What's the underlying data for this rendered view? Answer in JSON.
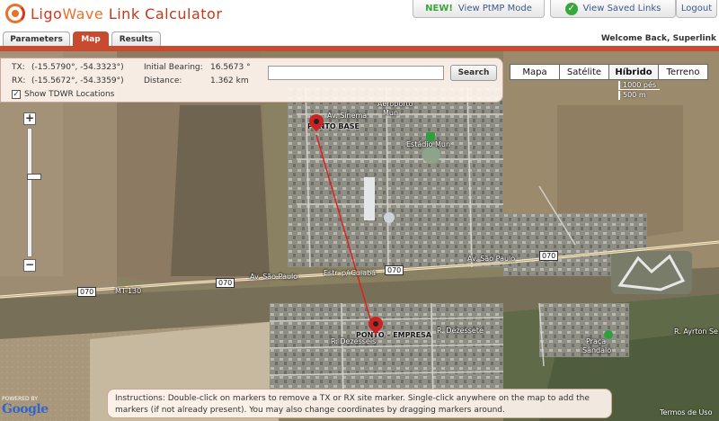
{
  "header": {
    "logo_ligo": "Ligo",
    "logo_wave": "Wave",
    "logo_rest": " Link Calculator",
    "ptmp_new": "NEW!",
    "ptmp_label": "View PtMP Mode",
    "saved_label": "View Saved Links",
    "logout_label": "Logout"
  },
  "tabs": [
    {
      "label": "Parameters"
    },
    {
      "label": "Map"
    },
    {
      "label": "Results"
    }
  ],
  "welcome": "Welcome Back, Superlink",
  "info": {
    "tx_label": "TX:",
    "tx_value": "(-15.5790°, -54.3323°)",
    "rx_label": "RX:",
    "rx_value": "(-15.5672°, -54.3359°)",
    "bearing_label": "Initial Bearing:",
    "bearing_value": "16.5673 °",
    "distance_label": "Distance:",
    "distance_value": "1.362 km",
    "tdwr_label": "Show TDWR Locations",
    "tdwr_checked": "✓"
  },
  "search": {
    "placeholder": "",
    "button": "Search"
  },
  "map_types": [
    "Mapa",
    "Satélite",
    "Híbrido",
    "Terreno"
  ],
  "scale": {
    "imperial": "1000 pés",
    "metric": "500 m"
  },
  "zoom": {
    "plus": "+",
    "minus": "−"
  },
  "map_labels": {
    "av_sinema": "Av. Sinema",
    "aeroporto": "Aeroporto",
    "mun": "Mun",
    "estadio": "Estádio Mun",
    "ponto_base": "PONTO BASE",
    "ponto_empresa": "PONTO – EMPRESA",
    "av_sao_paulo_1": "Av. São Paulo",
    "av_sao_paulo_2": "Av. São Paulo",
    "estr_cuiaba": "Estr. p/ Cuiabá",
    "mt130": "MT-130",
    "r_dezesseis": "R. Dezesseis",
    "r_dezessete": "R. Dezessete",
    "praca": "Praça",
    "sandalo": "Sândalo",
    "r_ayrton": "R. Ayrton Se",
    "shield_070a": "070",
    "shield_070b": "070",
    "shield_070c": "070",
    "shield_070d": "070"
  },
  "instructions": "Instructions: Double-click on markers to remove a TX or RX site marker. Single-click anywhere on the map to add the markers (if not already present). You may also change coordinates by dragging markers around.",
  "footer": {
    "powered_by": "POWERED BY",
    "google": "Google",
    "terms": "Termos de Uso"
  },
  "colors": {
    "accent": "#c94a2e",
    "new_green": "#3aa73a",
    "link_line": "#e02020"
  }
}
